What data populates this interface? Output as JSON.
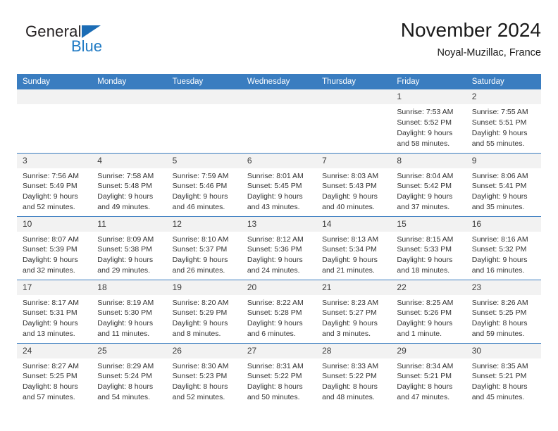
{
  "brand": {
    "name_part1": "General",
    "name_part2": "Blue",
    "triangle_color": "#1b6cb5",
    "blue_color": "#1f7ac4"
  },
  "header": {
    "title": "November 2024",
    "subtitle": "Noyal-Muzillac, France"
  },
  "theme": {
    "header_bg": "#3a7dc0",
    "daynum_bg": "#f2f2f2",
    "row_divider": "#3a7dc0",
    "text": "#333333"
  },
  "calendar": {
    "weekday_headers": [
      "Sunday",
      "Monday",
      "Tuesday",
      "Wednesday",
      "Thursday",
      "Friday",
      "Saturday"
    ],
    "weeks": [
      [
        {
          "day": "",
          "empty": true,
          "sunrise": "",
          "sunset": "",
          "daylight_line1": "",
          "daylight_line2": ""
        },
        {
          "day": "",
          "empty": true,
          "sunrise": "",
          "sunset": "",
          "daylight_line1": "",
          "daylight_line2": ""
        },
        {
          "day": "",
          "empty": true,
          "sunrise": "",
          "sunset": "",
          "daylight_line1": "",
          "daylight_line2": ""
        },
        {
          "day": "",
          "empty": true,
          "sunrise": "",
          "sunset": "",
          "daylight_line1": "",
          "daylight_line2": ""
        },
        {
          "day": "",
          "empty": true,
          "sunrise": "",
          "sunset": "",
          "daylight_line1": "",
          "daylight_line2": ""
        },
        {
          "day": "1",
          "empty": false,
          "sunrise": "Sunrise: 7:53 AM",
          "sunset": "Sunset: 5:52 PM",
          "daylight_line1": "Daylight: 9 hours",
          "daylight_line2": "and 58 minutes."
        },
        {
          "day": "2",
          "empty": false,
          "sunrise": "Sunrise: 7:55 AM",
          "sunset": "Sunset: 5:51 PM",
          "daylight_line1": "Daylight: 9 hours",
          "daylight_line2": "and 55 minutes."
        }
      ],
      [
        {
          "day": "3",
          "empty": false,
          "sunrise": "Sunrise: 7:56 AM",
          "sunset": "Sunset: 5:49 PM",
          "daylight_line1": "Daylight: 9 hours",
          "daylight_line2": "and 52 minutes."
        },
        {
          "day": "4",
          "empty": false,
          "sunrise": "Sunrise: 7:58 AM",
          "sunset": "Sunset: 5:48 PM",
          "daylight_line1": "Daylight: 9 hours",
          "daylight_line2": "and 49 minutes."
        },
        {
          "day": "5",
          "empty": false,
          "sunrise": "Sunrise: 7:59 AM",
          "sunset": "Sunset: 5:46 PM",
          "daylight_line1": "Daylight: 9 hours",
          "daylight_line2": "and 46 minutes."
        },
        {
          "day": "6",
          "empty": false,
          "sunrise": "Sunrise: 8:01 AM",
          "sunset": "Sunset: 5:45 PM",
          "daylight_line1": "Daylight: 9 hours",
          "daylight_line2": "and 43 minutes."
        },
        {
          "day": "7",
          "empty": false,
          "sunrise": "Sunrise: 8:03 AM",
          "sunset": "Sunset: 5:43 PM",
          "daylight_line1": "Daylight: 9 hours",
          "daylight_line2": "and 40 minutes."
        },
        {
          "day": "8",
          "empty": false,
          "sunrise": "Sunrise: 8:04 AM",
          "sunset": "Sunset: 5:42 PM",
          "daylight_line1": "Daylight: 9 hours",
          "daylight_line2": "and 37 minutes."
        },
        {
          "day": "9",
          "empty": false,
          "sunrise": "Sunrise: 8:06 AM",
          "sunset": "Sunset: 5:41 PM",
          "daylight_line1": "Daylight: 9 hours",
          "daylight_line2": "and 35 minutes."
        }
      ],
      [
        {
          "day": "10",
          "empty": false,
          "sunrise": "Sunrise: 8:07 AM",
          "sunset": "Sunset: 5:39 PM",
          "daylight_line1": "Daylight: 9 hours",
          "daylight_line2": "and 32 minutes."
        },
        {
          "day": "11",
          "empty": false,
          "sunrise": "Sunrise: 8:09 AM",
          "sunset": "Sunset: 5:38 PM",
          "daylight_line1": "Daylight: 9 hours",
          "daylight_line2": "and 29 minutes."
        },
        {
          "day": "12",
          "empty": false,
          "sunrise": "Sunrise: 8:10 AM",
          "sunset": "Sunset: 5:37 PM",
          "daylight_line1": "Daylight: 9 hours",
          "daylight_line2": "and 26 minutes."
        },
        {
          "day": "13",
          "empty": false,
          "sunrise": "Sunrise: 8:12 AM",
          "sunset": "Sunset: 5:36 PM",
          "daylight_line1": "Daylight: 9 hours",
          "daylight_line2": "and 24 minutes."
        },
        {
          "day": "14",
          "empty": false,
          "sunrise": "Sunrise: 8:13 AM",
          "sunset": "Sunset: 5:34 PM",
          "daylight_line1": "Daylight: 9 hours",
          "daylight_line2": "and 21 minutes."
        },
        {
          "day": "15",
          "empty": false,
          "sunrise": "Sunrise: 8:15 AM",
          "sunset": "Sunset: 5:33 PM",
          "daylight_line1": "Daylight: 9 hours",
          "daylight_line2": "and 18 minutes."
        },
        {
          "day": "16",
          "empty": false,
          "sunrise": "Sunrise: 8:16 AM",
          "sunset": "Sunset: 5:32 PM",
          "daylight_line1": "Daylight: 9 hours",
          "daylight_line2": "and 16 minutes."
        }
      ],
      [
        {
          "day": "17",
          "empty": false,
          "sunrise": "Sunrise: 8:17 AM",
          "sunset": "Sunset: 5:31 PM",
          "daylight_line1": "Daylight: 9 hours",
          "daylight_line2": "and 13 minutes."
        },
        {
          "day": "18",
          "empty": false,
          "sunrise": "Sunrise: 8:19 AM",
          "sunset": "Sunset: 5:30 PM",
          "daylight_line1": "Daylight: 9 hours",
          "daylight_line2": "and 11 minutes."
        },
        {
          "day": "19",
          "empty": false,
          "sunrise": "Sunrise: 8:20 AM",
          "sunset": "Sunset: 5:29 PM",
          "daylight_line1": "Daylight: 9 hours",
          "daylight_line2": "and 8 minutes."
        },
        {
          "day": "20",
          "empty": false,
          "sunrise": "Sunrise: 8:22 AM",
          "sunset": "Sunset: 5:28 PM",
          "daylight_line1": "Daylight: 9 hours",
          "daylight_line2": "and 6 minutes."
        },
        {
          "day": "21",
          "empty": false,
          "sunrise": "Sunrise: 8:23 AM",
          "sunset": "Sunset: 5:27 PM",
          "daylight_line1": "Daylight: 9 hours",
          "daylight_line2": "and 3 minutes."
        },
        {
          "day": "22",
          "empty": false,
          "sunrise": "Sunrise: 8:25 AM",
          "sunset": "Sunset: 5:26 PM",
          "daylight_line1": "Daylight: 9 hours",
          "daylight_line2": "and 1 minute."
        },
        {
          "day": "23",
          "empty": false,
          "sunrise": "Sunrise: 8:26 AM",
          "sunset": "Sunset: 5:25 PM",
          "daylight_line1": "Daylight: 8 hours",
          "daylight_line2": "and 59 minutes."
        }
      ],
      [
        {
          "day": "24",
          "empty": false,
          "sunrise": "Sunrise: 8:27 AM",
          "sunset": "Sunset: 5:25 PM",
          "daylight_line1": "Daylight: 8 hours",
          "daylight_line2": "and 57 minutes."
        },
        {
          "day": "25",
          "empty": false,
          "sunrise": "Sunrise: 8:29 AM",
          "sunset": "Sunset: 5:24 PM",
          "daylight_line1": "Daylight: 8 hours",
          "daylight_line2": "and 54 minutes."
        },
        {
          "day": "26",
          "empty": false,
          "sunrise": "Sunrise: 8:30 AM",
          "sunset": "Sunset: 5:23 PM",
          "daylight_line1": "Daylight: 8 hours",
          "daylight_line2": "and 52 minutes."
        },
        {
          "day": "27",
          "empty": false,
          "sunrise": "Sunrise: 8:31 AM",
          "sunset": "Sunset: 5:22 PM",
          "daylight_line1": "Daylight: 8 hours",
          "daylight_line2": "and 50 minutes."
        },
        {
          "day": "28",
          "empty": false,
          "sunrise": "Sunrise: 8:33 AM",
          "sunset": "Sunset: 5:22 PM",
          "daylight_line1": "Daylight: 8 hours",
          "daylight_line2": "and 48 minutes."
        },
        {
          "day": "29",
          "empty": false,
          "sunrise": "Sunrise: 8:34 AM",
          "sunset": "Sunset: 5:21 PM",
          "daylight_line1": "Daylight: 8 hours",
          "daylight_line2": "and 47 minutes."
        },
        {
          "day": "30",
          "empty": false,
          "sunrise": "Sunrise: 8:35 AM",
          "sunset": "Sunset: 5:21 PM",
          "daylight_line1": "Daylight: 8 hours",
          "daylight_line2": "and 45 minutes."
        }
      ]
    ]
  }
}
